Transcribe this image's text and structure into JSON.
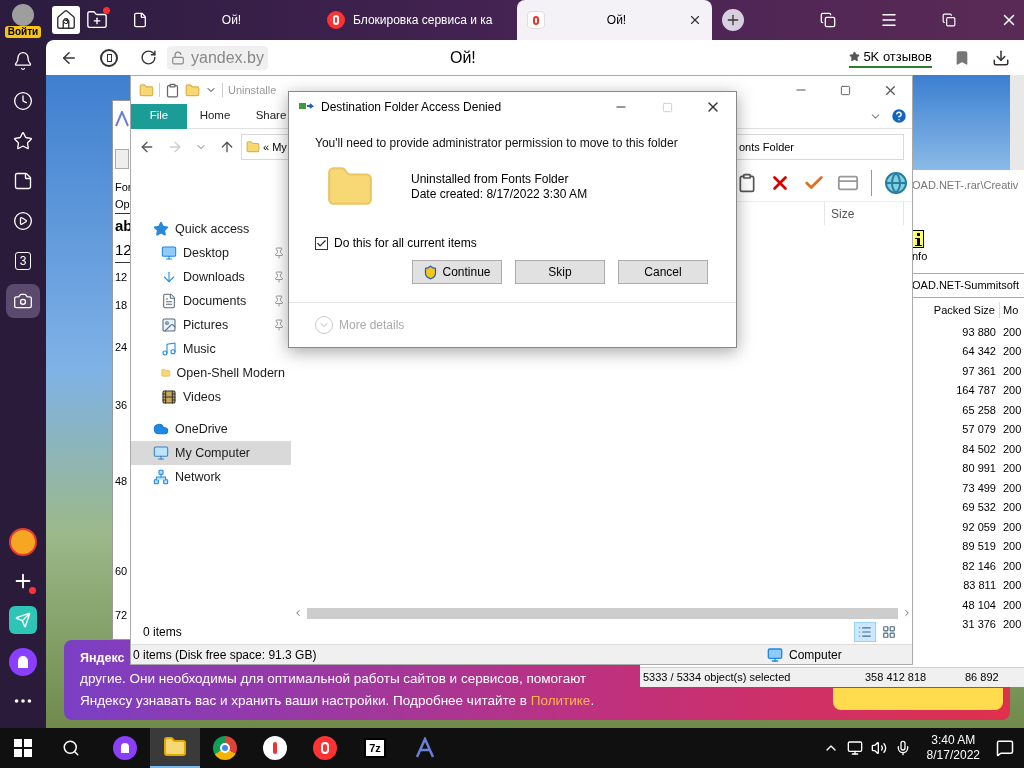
{
  "browser": {
    "profile_label": "Войти",
    "tab_counter": "3",
    "tabs": [
      {
        "kind": "page",
        "title": "Ой!",
        "selected": false
      },
      {
        "kind": "yandex",
        "title": "Блокировка сервиса и ка",
        "selected": false
      },
      {
        "kind": "yandex-doc",
        "title": "Ой!",
        "selected": true
      }
    ],
    "address": "yandex.by",
    "page_title": "Ой!",
    "reviews": "5K отзывов",
    "sidebar": [
      {
        "kind": "bell",
        "selected": false
      },
      {
        "kind": "clock",
        "selected": false
      },
      {
        "kind": "star",
        "selected": false
      },
      {
        "kind": "notes",
        "selected": false
      },
      {
        "kind": "play",
        "selected": false
      },
      {
        "kind": "counter",
        "label": "3",
        "selected": false
      },
      {
        "kind": "camera",
        "selected": true
      }
    ],
    "sidebar_bottom": [
      {
        "kind": "mail"
      },
      {
        "kind": "add"
      },
      {
        "kind": "send"
      },
      {
        "kind": "alice"
      },
      {
        "kind": "more"
      }
    ]
  },
  "cookie_banner": {
    "heading": "Яндекс",
    "line_1": "другие. Они необходимы для оптимальной работы сайтов и сервисов, помогают",
    "line_2": "Яндексу узнавать вас и хранить ваши настройки. Подробнее читайте в",
    "link": "Политике",
    "line_end": "."
  },
  "font_viewer": {
    "samples": [
      "For",
      "Op"
    ],
    "preview": [
      "ab",
      "12"
    ],
    "sizes": [
      "12",
      "18",
      "24",
      "36",
      "48",
      "60",
      "72"
    ]
  },
  "archive": {
    "path": "OAD.NET-.rar\\Creativ",
    "info_label": "nfo",
    "folder": "OAD.NET-Summitsoft",
    "columns": [
      "Packed Size",
      "Mo"
    ],
    "rows": [
      {
        "packed": "93 880",
        "modified": "200"
      },
      {
        "packed": "64 342",
        "modified": "200"
      },
      {
        "packed": "97 361",
        "modified": "200"
      },
      {
        "packed": "164 787",
        "modified": "200"
      },
      {
        "packed": "65 258",
        "modified": "200"
      },
      {
        "packed": "57 079",
        "modified": "200"
      },
      {
        "packed": "84 502",
        "modified": "200"
      },
      {
        "packed": "80 991",
        "modified": "200"
      },
      {
        "packed": "73 499",
        "modified": "200"
      },
      {
        "packed": "69 532",
        "modified": "200"
      },
      {
        "packed": "92 059",
        "modified": "200"
      },
      {
        "packed": "89 519",
        "modified": "200"
      },
      {
        "packed": "82 146",
        "modified": "200"
      },
      {
        "packed": "83 811",
        "modified": "200"
      },
      {
        "packed": "48 104",
        "modified": "200"
      },
      {
        "packed": "31 376",
        "modified": "200"
      }
    ],
    "status": [
      "5333 / 5334 object(s) selected",
      "358 412 818",
      "86 892"
    ]
  },
  "explorer": {
    "title": "Uninstalle",
    "ribbon_tabs": [
      {
        "label": "File",
        "selected": true
      },
      {
        "label": "Home",
        "selected": false
      },
      {
        "label": "Share",
        "selected": false
      }
    ],
    "forward_disabled": true,
    "address_prefix": "«",
    "address_start": "My",
    "address_end": "onts Folder",
    "column": "Size",
    "nav": [
      {
        "kind": "star",
        "label": "Quick access",
        "selected": false,
        "children": [
          {
            "kind": "desktop",
            "label": "Desktop",
            "pinned": true,
            "selected": false
          },
          {
            "kind": "download",
            "label": "Downloads",
            "pinned": true,
            "selected": false
          },
          {
            "kind": "document",
            "label": "Documents",
            "pinned": true,
            "selected": false
          },
          {
            "kind": "picture",
            "label": "Pictures",
            "pinned": true,
            "selected": false
          },
          {
            "kind": "music",
            "label": "Music",
            "pinned": false,
            "selected": false
          },
          {
            "kind": "folder",
            "label": "Open-Shell Modern",
            "pinned": false,
            "selected": false
          },
          {
            "kind": "video",
            "label": "Videos",
            "pinned": false,
            "selected": false
          }
        ]
      },
      {
        "kind": "cloud",
        "label": "OneDrive",
        "selected": false
      },
      {
        "kind": "computer",
        "label": "My Computer",
        "selected": true
      },
      {
        "kind": "network",
        "label": "Network",
        "selected": false
      }
    ],
    "item_count": "0 items",
    "views": [
      {
        "kind": "details",
        "selected": true
      },
      {
        "kind": "tiles",
        "selected": false
      }
    ],
    "shell_status": "0 items (Disk free space: 91.3 GB)",
    "shell_location": "Computer"
  },
  "dialog": {
    "title": "Destination Folder Access Denied",
    "maximize_disabled": true,
    "message": "You'll need to provide administrator permission to move to this folder",
    "item_name": "Uninstalled from Fonts Folder",
    "item_date": "Date created: 8/17/2022 3:30 AM",
    "checkbox": {
      "label": "Do this for all current items",
      "checked": true
    },
    "buttons": [
      {
        "kind": "uac",
        "label": "Continue"
      },
      {
        "kind": "plain",
        "label": "Skip"
      },
      {
        "kind": "plain",
        "label": "Cancel"
      }
    ],
    "details": {
      "label": "More details",
      "disabled": true
    }
  },
  "taskbar": {
    "apps": [
      {
        "kind": "alice",
        "selected": false
      },
      {
        "kind": "explorer",
        "selected": true
      },
      {
        "kind": "chrome",
        "selected": false
      },
      {
        "kind": "yandex-browser",
        "selected": false
      },
      {
        "kind": "yandex",
        "selected": false
      },
      {
        "kind": "archiver",
        "label": "7z",
        "selected": false
      },
      {
        "kind": "font-viewer",
        "selected": false
      }
    ],
    "time": "3:40 AM",
    "date": "8/17/2022"
  }
}
